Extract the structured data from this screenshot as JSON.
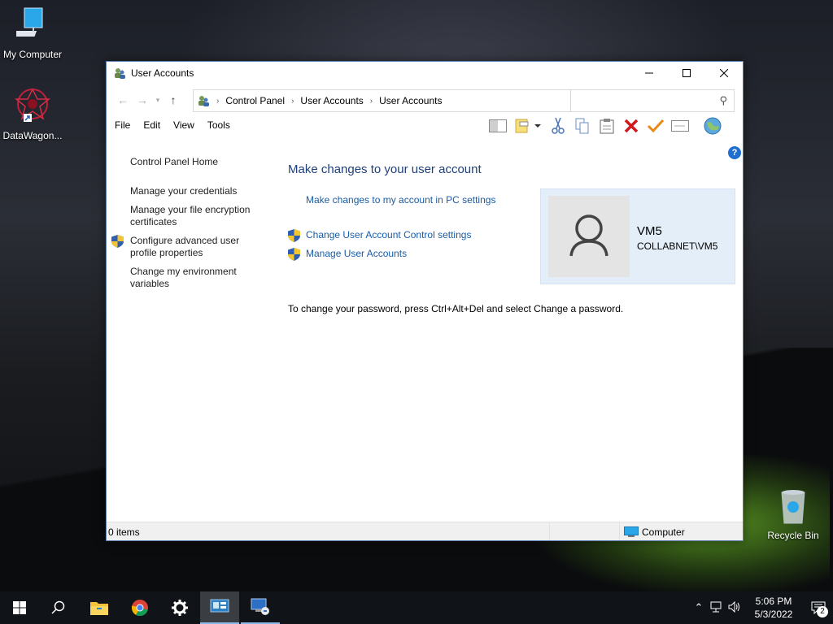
{
  "desktop": {
    "icons": [
      {
        "label": "My Computer"
      },
      {
        "label": "DataWagon..."
      },
      {
        "label": "Recycle Bin"
      }
    ]
  },
  "window": {
    "title": "User Accounts",
    "breadcrumb": [
      "Control Panel",
      "User Accounts",
      "User Accounts"
    ],
    "search": {
      "placeholder": "",
      "value": ""
    },
    "menu": [
      "File",
      "Edit",
      "View",
      "Tools"
    ],
    "left_pane": {
      "links": [
        "Control Panel Home",
        "Manage your credentials",
        "Manage your file encryption certificates",
        "Configure advanced user profile properties",
        "Change my environment variables"
      ]
    },
    "main": {
      "title": "Make changes to your user account",
      "pc_settings_link": "Make changes to my account in PC settings",
      "uac_link": "Change User Account Control settings",
      "manage_link": "Manage User Accounts",
      "password_note": "To change your password, press Ctrl+Alt+Del and select Change a password."
    },
    "user": {
      "name": "VM5",
      "domain": "COLLABNET\\VM5"
    },
    "status": {
      "items": "0 items",
      "location": "Computer"
    }
  },
  "taskbar": {
    "time": "5:06 PM",
    "date": "5/3/2022",
    "notification_count": "2"
  },
  "colors": {
    "link": "#1a5da8",
    "title": "#1d3f7a",
    "user_card_bg": "#e4eef9",
    "taskbar_bg": "#101318"
  }
}
